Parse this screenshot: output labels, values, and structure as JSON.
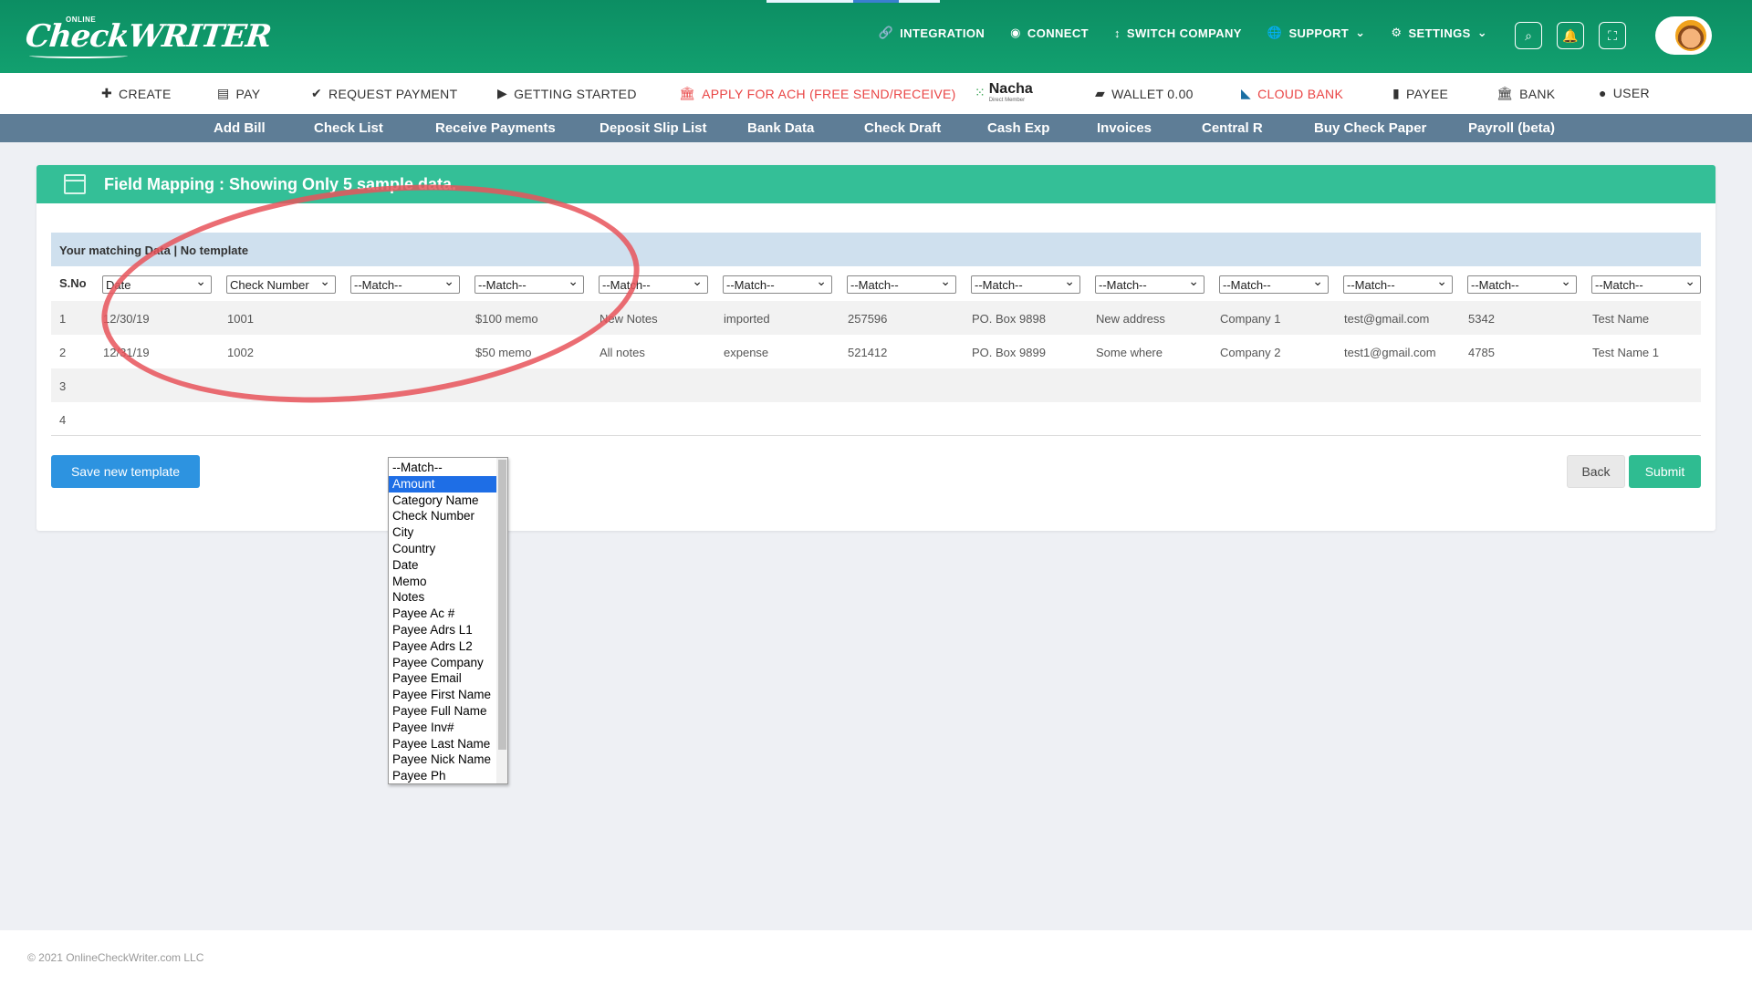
{
  "brand": {
    "small": "ONLINE",
    "name": "CheckWRITER"
  },
  "topnav": [
    {
      "label": "INTEGRATION",
      "icon": "🔗"
    },
    {
      "label": "CONNECT",
      "icon": "◉"
    },
    {
      "label": "SWITCH COMPANY",
      "icon": "↕"
    },
    {
      "label": "SUPPORT",
      "icon": "🌐",
      "caret": "⌄"
    },
    {
      "label": "SETTINGS",
      "icon": "⚙",
      "caret": "⌄"
    }
  ],
  "top_icons": {
    "search": "⌕",
    "bell": "🔔",
    "fullscreen": "⛶"
  },
  "mainnav": {
    "create": "CREATE",
    "pay": "PAY",
    "request_payment": "REQUEST PAYMENT",
    "getting_started": "GETTING STARTED",
    "apply_ach": "APPLY FOR ACH (FREE SEND/RECEIVE)",
    "nacha": "Nacha",
    "nacha_sub": "Direct Member",
    "wallet": "WALLET 0.00",
    "cloud_bank": "CLOUD BANK",
    "payee": "PAYEE",
    "bank": "BANK",
    "user": "USER"
  },
  "subnav": [
    "Add Bill",
    "Check List",
    "Receive Payments",
    "Deposit Slip List",
    "Bank Data",
    "Check Draft",
    "Cash Exp",
    "Invoices",
    "Central R",
    "Buy Check Paper",
    "Payroll (beta)"
  ],
  "card": {
    "title": "Field Mapping : Showing Only 5 sample data.",
    "info": "Your matching Data | No template"
  },
  "table": {
    "sno_header": "S.No",
    "selects": [
      "Date",
      "Check Number",
      "--Match--",
      "--Match--",
      "--Match--",
      "--Match--",
      "--Match--",
      "--Match--",
      "--Match--",
      "--Match--",
      "--Match--",
      "--Match--",
      "--Match--"
    ],
    "rows": [
      {
        "sno": "1",
        "cells": [
          "12/30/19",
          "1001",
          "",
          "$100 memo",
          "New Notes",
          "imported",
          "257596",
          "PO. Box 9898",
          "New address",
          "Company 1",
          "test@gmail.com",
          "5342",
          "Test Name"
        ]
      },
      {
        "sno": "2",
        "cells": [
          "12/31/19",
          "1002",
          "",
          "$50 memo",
          "All notes",
          "expense",
          "521412",
          "PO. Box 9899",
          "Some where",
          "Company 2",
          "test1@gmail.com",
          "4785",
          "Test Name 1"
        ]
      },
      {
        "sno": "3",
        "cells": [
          "",
          "",
          "",
          "",
          "",
          "",
          "",
          "",
          "",
          "",
          "",
          "",
          ""
        ]
      },
      {
        "sno": "4",
        "cells": [
          "",
          "",
          "",
          "",
          "",
          "",
          "",
          "",
          "",
          "",
          "",
          "",
          ""
        ]
      }
    ]
  },
  "dropdown": {
    "selected": "Amount",
    "options": [
      "--Match--",
      "Amount",
      "Category Name",
      "Check Number",
      "City",
      "Country",
      "Date",
      "Memo",
      "Notes",
      "Payee Ac #",
      "Payee Adrs L1",
      "Payee Adrs L2",
      "Payee Company",
      "Payee Email",
      "Payee First Name",
      "Payee Full Name",
      "Payee Inv#",
      "Payee Last Name",
      "Payee Nick Name",
      "Payee Ph"
    ]
  },
  "buttons": {
    "save_template": "Save new template",
    "back": "Back",
    "submit": "Submit"
  },
  "footer": {
    "copyright": "© 2021 OnlineCheckWriter.com LLC"
  },
  "colors": {
    "header_green": "#12a06f",
    "subnav": "#5e7d96",
    "card_head": "#34bf97",
    "ach_red": "#e94444",
    "save_blue": "#2d93e0",
    "annotation_red": "#e8545a"
  }
}
